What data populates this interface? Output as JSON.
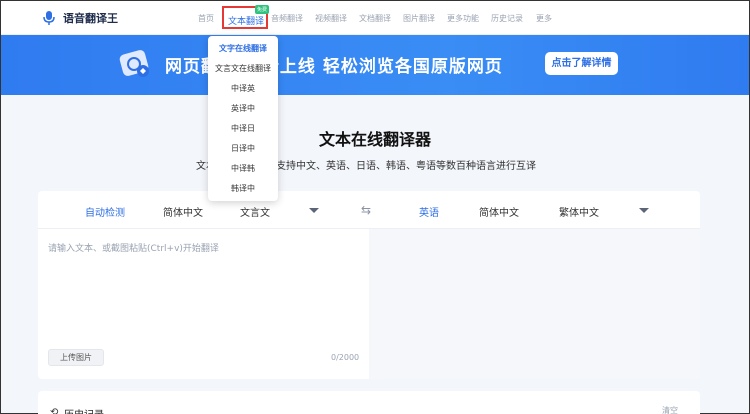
{
  "app": {
    "name": "语音翻译王"
  },
  "nav": {
    "items": [
      "首页",
      "音频翻译",
      "视频翻译",
      "文档翻译",
      "图片翻译",
      "更多功能",
      "历史记录",
      "更多"
    ],
    "active": "文本翻译",
    "active_badge": "免费"
  },
  "dropdown": {
    "items": [
      "文字在线翻译",
      "文言文在线翻译",
      "中译英",
      "英译中",
      "中译日",
      "日译中",
      "中译韩",
      "韩译中"
    ]
  },
  "banner": {
    "text": "网页翻译 全新上线  轻松浏览各国原版网页",
    "button": "点击了解详情"
  },
  "main": {
    "title": "文本在线翻译器",
    "subtitle": "文本在线翻译器，支持中文、英语、日语、韩语、粤语等数百种语言进行互译"
  },
  "translator": {
    "source_langs": [
      "自动检测",
      "简体中文",
      "文言文"
    ],
    "target_langs": [
      "英语",
      "简体中文",
      "繁体中文"
    ],
    "placeholder": "请输入文本、或截图粘贴(Ctrl+v)开始翻译",
    "upload_label": "上传图片",
    "counter": "0/2000"
  },
  "history": {
    "label": "历史记录",
    "clear": "清空"
  },
  "colors": {
    "accent": "#2f6fe4",
    "banner": "#2f7bf0",
    "badge": "#2ec27e",
    "highlight": "#e53935"
  }
}
